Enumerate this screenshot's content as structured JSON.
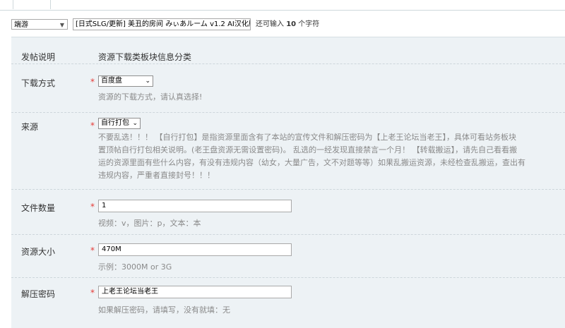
{
  "top_select": {
    "value": "端游"
  },
  "subject": {
    "value": "[日式SLG/更新] 美丑的房间 みぃあルーム v1.2 AI汉化版"
  },
  "char_tip": {
    "prefix": "还可输入 ",
    "count": "10",
    "suffix": " 个字符"
  },
  "post_info": {
    "label": "发帖说明",
    "text": "资源下载类板块信息分类"
  },
  "download_method": {
    "label": "下载方式",
    "required": "*",
    "value": "百度盘",
    "hint": "资源的下载方式，请认真选择!"
  },
  "source": {
    "label": "来源",
    "required": "*",
    "value": "自行打包",
    "hint_lines": [
      "不要乱选！！！ 【自行打包】是指资源里面含有了本站的宣传文件和解压密码为【上老王论坛当老王】，具体可看站务板块",
      "置顶帖自行打包相关说明。(老王盘资源无需设置密码)。 乱选的一经发现直接禁言一个月！ 【转载搬运】，请先自己看看搬",
      "运的资源里面有些什么内容，有没有违规内容（幼女，大量广告，文不对题等等）如果乱搬运资源，未经检查乱搬运，查出有",
      "违规内容，严重者直接封号！！！"
    ]
  },
  "file_count": {
    "label": "文件数量",
    "required": "*",
    "value": "1",
    "hint": "视频：v，图片：p，文本：本"
  },
  "resource_size": {
    "label": "资源大小",
    "required": "*",
    "value": "470M",
    "hint": "示例：3000M or 3G"
  },
  "unzip_password": {
    "label": "解压密码",
    "required": "*",
    "value": "上老王论坛当老王",
    "hint": "如果解压密码，请填写，没有就填：无"
  }
}
